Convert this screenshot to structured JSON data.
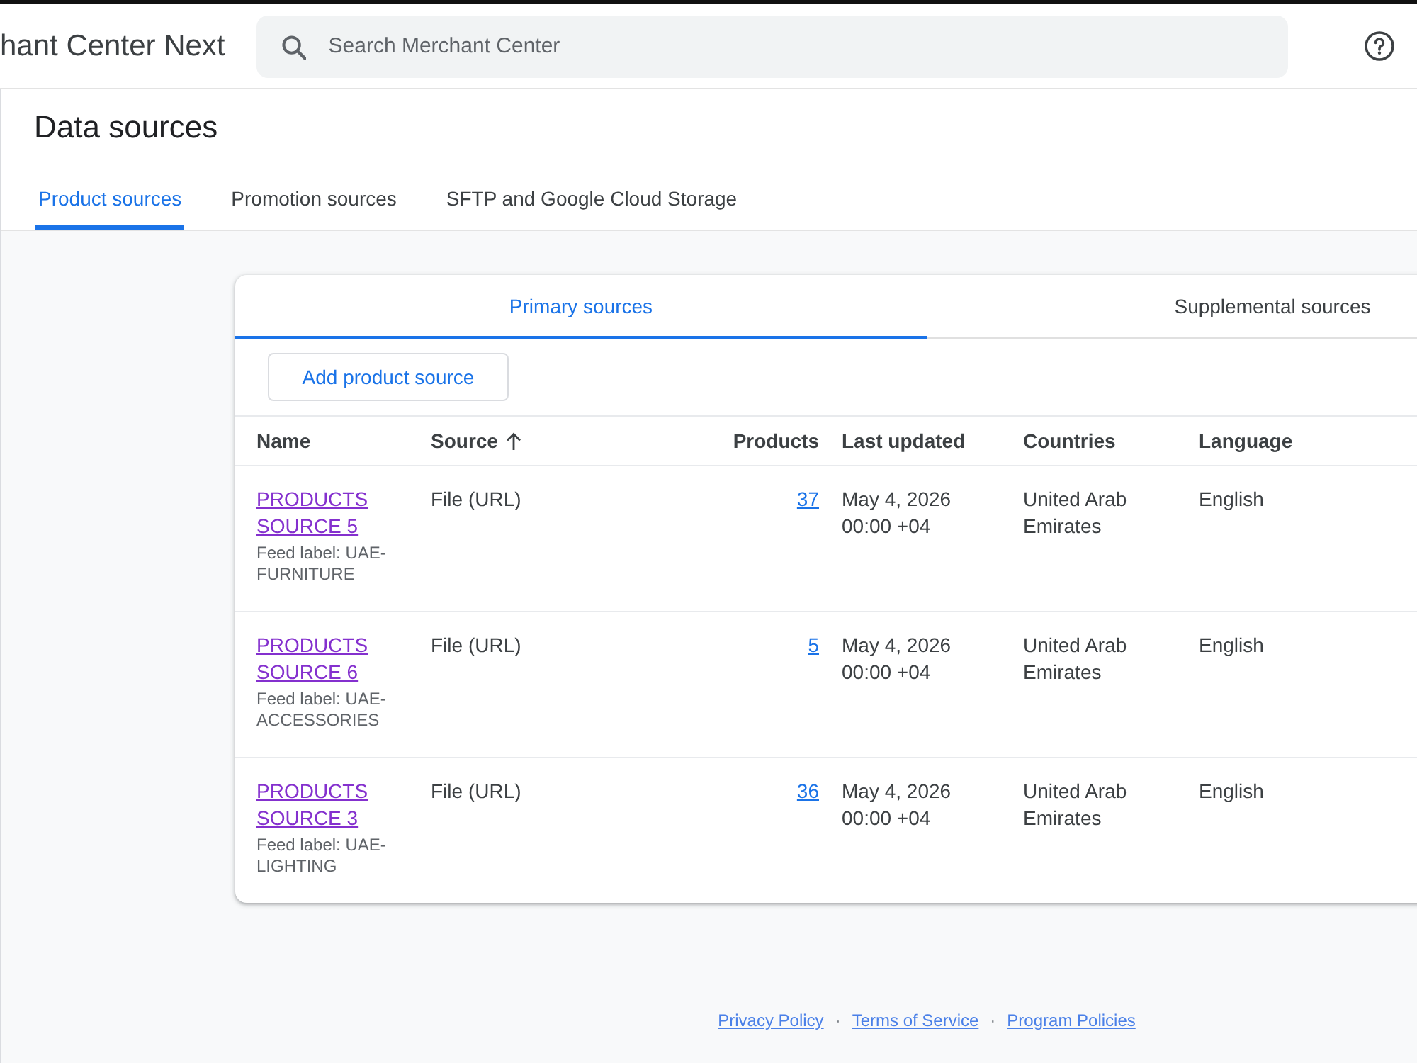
{
  "app_bar": {
    "title": "hant Center Next",
    "search": {
      "placeholder": "Search Merchant Center"
    }
  },
  "page": {
    "title": "Data sources",
    "tabs": [
      {
        "label": "Product sources",
        "selected": true
      },
      {
        "label": "Promotion sources",
        "selected": false
      },
      {
        "label": "SFTP and Google Cloud Storage",
        "selected": false
      }
    ]
  },
  "sources_card": {
    "tabs": [
      {
        "label": "Primary sources",
        "selected": true
      },
      {
        "label": "Supplemental sources",
        "selected": false
      }
    ],
    "add_button": "Add product source",
    "table": {
      "columns": [
        {
          "label": "Name",
          "sorted": false
        },
        {
          "label": "Source",
          "sorted": true
        },
        {
          "label": "Products",
          "sorted": false
        },
        {
          "label": "Last updated",
          "sorted": false
        },
        {
          "label": "Countries",
          "sorted": false
        },
        {
          "label": "Language",
          "sorted": false
        }
      ],
      "rows": [
        {
          "name": {
            "label": "PRODUCTS SOURCE 5",
            "visited": true
          },
          "feed_label": "Feed label: UAE-FURNITURE",
          "source": "File (URL)",
          "products": {
            "label": "37",
            "visited": false
          },
          "last_updated": "May 4, 2026 00:00 +04",
          "countries": "United Arab Emirates",
          "language": "English"
        },
        {
          "name": {
            "label": "PRODUCTS SOURCE 6",
            "visited": true
          },
          "feed_label": "Feed label: UAE-ACCESSORIES",
          "source": "File (URL)",
          "products": {
            "label": "5",
            "visited": false
          },
          "last_updated": "May 4, 2026 00:00 +04",
          "countries": "United Arab Emirates",
          "language": "English"
        },
        {
          "name": {
            "label": "PRODUCTS SOURCE 3",
            "visited": true
          },
          "feed_label": "Feed label: UAE-LIGHTING",
          "source": "File (URL)",
          "products": {
            "label": "36",
            "visited": false
          },
          "last_updated": "May 4, 2026 00:00 +04",
          "countries": "United Arab Emirates",
          "language": "English"
        }
      ]
    }
  },
  "footer": {
    "items": [
      {
        "kind": "link",
        "label": "Privacy Policy"
      },
      {
        "kind": "separator",
        "label": "·"
      },
      {
        "kind": "link",
        "label": "Terms of Service"
      },
      {
        "kind": "separator",
        "label": "·"
      },
      {
        "kind": "link",
        "label": "Program Policies"
      }
    ]
  }
}
